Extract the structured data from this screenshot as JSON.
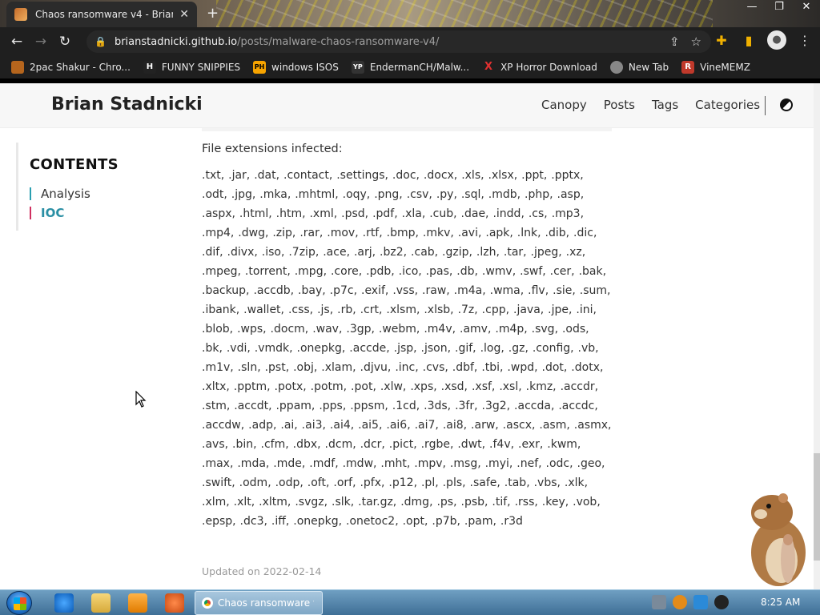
{
  "browser": {
    "tab_title": "Chaos ransomware v4 - Brian Stadnicki",
    "tab_close": "✕",
    "new_tab": "+",
    "window_controls": [
      "—",
      "❐",
      "✕"
    ],
    "url_host": "brianstadnicki.github.io",
    "url_path": "/posts/malware-chaos-ransomware-v4/",
    "bookmarks": [
      {
        "label": "2pac Shakur - Chro...",
        "icon": "music-icon",
        "icon_glyph": "",
        "color": "#b5651d"
      },
      {
        "label": "FUNNY SNIPPIES",
        "icon": "h-icon",
        "icon_glyph": "H",
        "color": "#222222"
      },
      {
        "label": "windows ISOS",
        "icon": "ph-icon",
        "icon_glyph": "PH",
        "color": "#f7a400"
      },
      {
        "label": "EndermanCH/Malw...",
        "icon": "yp-icon",
        "icon_glyph": "YP",
        "color": "#333333"
      },
      {
        "label": "XP Horror Download",
        "icon": "x-icon",
        "icon_glyph": "X",
        "color": "#c0392b"
      },
      {
        "label": "New Tab",
        "icon": "globe-icon",
        "icon_glyph": "",
        "color": "#888888"
      },
      {
        "label": "VineMEMZ",
        "icon": "r-icon",
        "icon_glyph": "R",
        "color": "#c0392b"
      }
    ]
  },
  "site": {
    "title": "Brian Stadnicki",
    "nav": [
      "Canopy",
      "Posts",
      "Tags",
      "Categories"
    ]
  },
  "toc": {
    "title": "CONTENTS",
    "items": [
      "Analysis",
      "IOC"
    ]
  },
  "content": {
    "heading": "File extensions infected:",
    "extensions": ".txt, .jar, .dat, .contact, .settings, .doc, .docx, .xls, .xlsx, .ppt, .pptx, .odt, .jpg, .mka, .mhtml, .oqy, .png, .csv, .py, .sql, .mdb, .php, .asp, .aspx, .html, .htm, .xml, .psd, .pdf, .xla, .cub, .dae, .indd, .cs, .mp3, .mp4, .dwg, .zip, .rar, .mov, .rtf, .bmp, .mkv, .avi, .apk, .lnk, .dib, .dic, .dif, .divx, .iso, .7zip, .ace, .arj, .bz2, .cab, .gzip, .lzh, .tar, .jpeg, .xz, .mpeg, .torrent, .mpg, .core, .pdb, .ico, .pas, .db, .wmv, .swf, .cer, .bak, .backup, .accdb, .bay, .p7c, .exif, .vss, .raw, .m4a, .wma, .flv, .sie, .sum, .ibank, .wallet, .css, .js, .rb, .crt, .xlsm, .xlsb, .7z, .cpp, .java, .jpe, .ini, .blob, .wps, .docm, .wav, .3gp, .webm, .m4v, .amv, .m4p, .svg, .ods, .bk, .vdi, .vmdk, .onepkg, .accde, .jsp, .json, .gif, .log, .gz, .config, .vb, .m1v, .sln, .pst, .obj, .xlam, .djvu, .inc, .cvs, .dbf, .tbi, .wpd, .dot, .dotx, .xltx, .pptm, .potx, .potm, .pot, .xlw, .xps, .xsd, .xsf, .xsl, .kmz, .accdr, .stm, .accdt, .ppam, .pps, .ppsm, .1cd, .3ds, .3fr, .3g2, .accda, .accdc, .accdw, .adp, .ai, .ai3, .ai4, .ai5, .ai6, .ai7, .ai8, .arw, .ascx, .asm, .asmx, .avs, .bin, .cfm, .dbx, .dcm, .dcr, .pict, .rgbe, .dwt, .f4v, .exr, .kwm, .max, .mda, .mde, .mdf, .mdw, .mht, .mpv, .msg, .myi, .nef, .odc, .geo, .swift, .odm, .odp, .oft, .orf, .pfx, .p12, .pl, .pls, .safe, .tab, .vbs, .xlk, .xlm, .xlt, .xltm, .svgz, .slk, .tar.gz, .dmg, .ps, .psb, .tif, .rss, .key, .vob, .epsp, .dc3, .iff, .onepkg, .onetoc2, .opt, .p7b, .pam, .r3d",
    "updated": "Updated on 2022-02-14"
  },
  "taskbar": {
    "window_label": "Chaos ransomware v...",
    "clock": "8:25 AM"
  },
  "colors": {
    "accent": "#2a8fa4",
    "toc_active_bar": "#d03060"
  }
}
